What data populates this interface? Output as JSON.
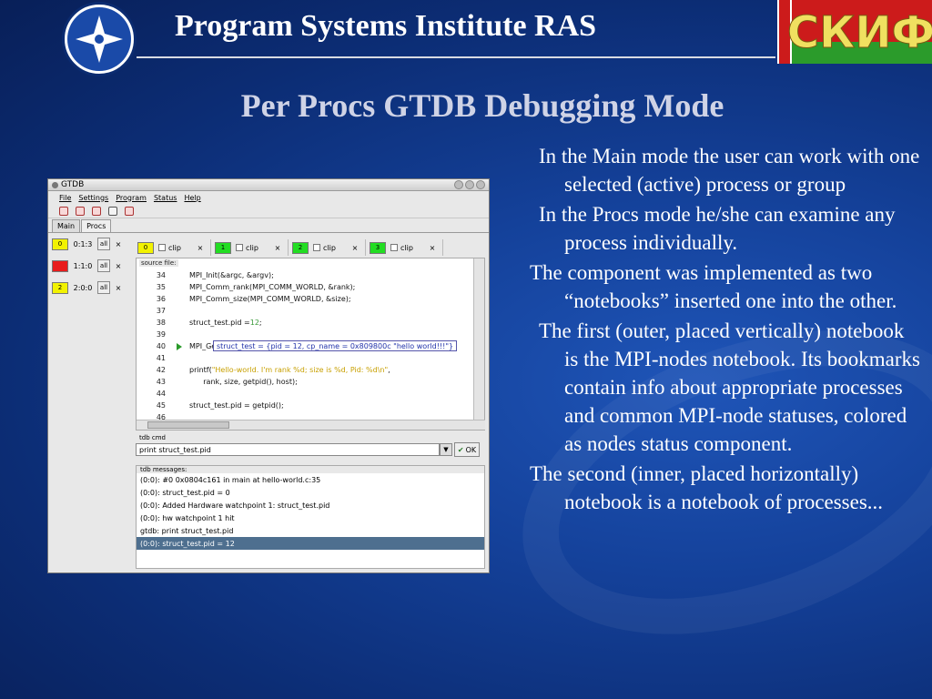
{
  "header": {
    "institute": "Program Systems Institute RAS",
    "skif_logo": "СКИФ",
    "slide_title": "Per Procs GTDB Debugging Mode"
  },
  "bullets": [
    "In the Main mode the user can work with one selected (active) process or group",
    "In the Procs mode he/she can examine any process individually.",
    "The component was implemented as two “notebooks” inserted one into the other.",
    "The first (outer, placed vertically) notebook is the MPI-nodes notebook. Its bookmarks contain info about appropriate processes and common MPI-node statuses, colored as nodes status component.",
    "The second (inner, placed horizontally) notebook is a notebook of processes..."
  ],
  "window": {
    "title": "GTDB",
    "menu": [
      "File",
      "Settings",
      "Program",
      "Status",
      "Help"
    ],
    "outer_tabs": [
      "Main",
      "Procs"
    ],
    "nodes": [
      {
        "badge": "0",
        "rank": "0:1:3",
        "all": "all",
        "close": "×",
        "color": "#f2f200"
      },
      {
        "badge": "1",
        "rank": "1:1:0",
        "all": "all",
        "close": "×",
        "color": "#e81c1c"
      },
      {
        "badge": "2",
        "rank": "2:0:0",
        "all": "all",
        "close": "×",
        "color": "#f2f200"
      }
    ],
    "proc_tabs": [
      {
        "badge": "0",
        "label": "clip",
        "close": "×",
        "color": "#f2f200"
      },
      {
        "badge": "1",
        "label": "clip",
        "close": "×",
        "color": "#22dd22"
      },
      {
        "badge": "2",
        "label": "clip",
        "close": "×",
        "color": "#22dd22"
      },
      {
        "badge": "3",
        "label": "clip",
        "close": "×",
        "color": "#22dd22"
      }
    ],
    "source_label": "source file:",
    "source_lines": [
      {
        "n": "34",
        "code": "MPI_Init(&argc, &argv);"
      },
      {
        "n": "35",
        "code": "MPI_Comm_rank(MPI_COMM_WORLD, &rank);"
      },
      {
        "n": "36",
        "code": "MPI_Comm_size(MPI_COMM_WORLD, &size);"
      },
      {
        "n": "37",
        "code": ""
      },
      {
        "n": "38",
        "code_a": "struct_test.pid = ",
        "code_b": "12",
        "code_c": ";"
      },
      {
        "n": "39",
        "code": ""
      },
      {
        "n": "40",
        "code": "MPI_Get_processor_name (host, &len);"
      },
      {
        "n": "41",
        "code": ""
      },
      {
        "n": "42",
        "code_a": "printf(",
        "code_b": "\"Hello-world. I'm rank %d; size is %d, Pid: %d\\n\"",
        "code_c": ","
      },
      {
        "n": "43",
        "code": "      rank, size, getpid(), host);"
      },
      {
        "n": "44",
        "code": ""
      },
      {
        "n": "45",
        "code": "struct_test.pid = getpid();"
      },
      {
        "n": "46",
        "code": ""
      }
    ],
    "tooltip": "struct_test = {pid = 12, cp_name = 0x809800c \"hello world!!!\"}",
    "cmd_label": "tdb cmd",
    "cmd_value": "print struct_test.pid",
    "ok_label": "OK",
    "msgs_label": "tdb messages:",
    "messages": [
      "(0:0): #0 0x0804c161 in main at hello-world.c:35",
      "(0:0): struct_test.pid = 0",
      "(0:0): Added Hardware watchpoint 1: struct_test.pid",
      "(0:0): hw watchpoint 1 hit",
      "gtdb: print struct_test.pid",
      "(0:0): struct_test.pid = 12"
    ]
  }
}
